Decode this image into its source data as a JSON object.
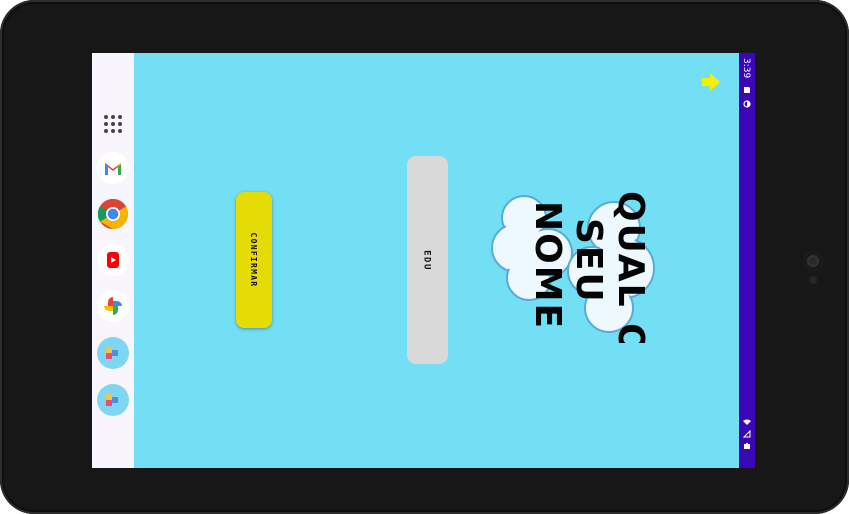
{
  "status_bar": {
    "time": "3:39",
    "icons": [
      "sim-card-icon",
      "data-saver-icon",
      "wifi-icon",
      "signal-icon",
      "battery-icon"
    ],
    "background": "#3b05b8"
  },
  "taskbar": {
    "items": [
      {
        "name": "app-drawer-icon"
      },
      {
        "name": "gmail-icon"
      },
      {
        "name": "chrome-icon"
      },
      {
        "name": "youtube-icon"
      },
      {
        "name": "google-photos-icon"
      },
      {
        "name": "kids-app-icon"
      },
      {
        "name": "kids-app-icon"
      }
    ]
  },
  "app": {
    "background": "#72dff4",
    "title_lines": [
      "QUAL O",
      "SEU",
      "NOME"
    ],
    "name_input_value": "EDU",
    "confirm_label": "CONFIRMAR",
    "confirm_color": "#e5dc06",
    "back_icon": "yellow-arrow-icon",
    "back_color": "#f5f200"
  }
}
